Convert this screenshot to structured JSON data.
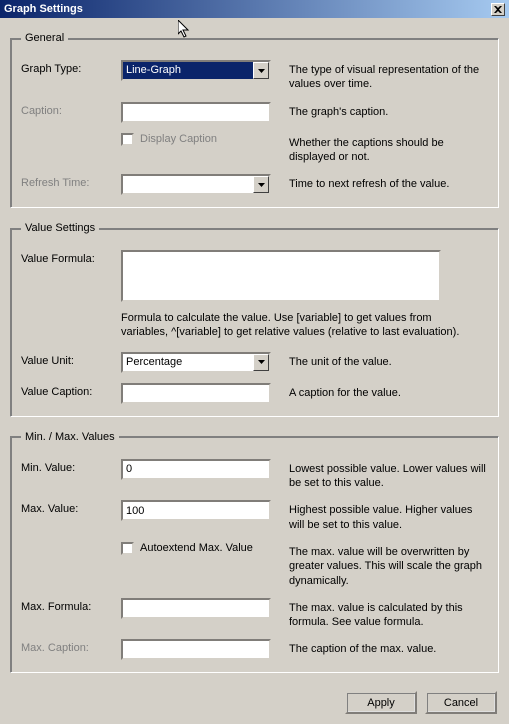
{
  "window": {
    "title": "Graph Settings"
  },
  "general": {
    "legend": "General",
    "graph_type": {
      "label": "Graph Type:",
      "value": "Line-Graph",
      "desc": "The type of visual representation of the values over time."
    },
    "caption": {
      "label": "Caption:",
      "value": "",
      "desc": "The graph's caption."
    },
    "display_caption": {
      "label": "Display Caption",
      "desc": "Whether the captions should be displayed or not."
    },
    "refresh_time": {
      "label": "Refresh Time:",
      "value": "",
      "desc": "Time to next refresh of the value."
    }
  },
  "value_settings": {
    "legend": "Value Settings",
    "formula": {
      "label": "Value Formula:",
      "value": "",
      "desc": "Formula to calculate the value. Use [variable] to get values from variables, ^[variable] to get relative values (relative to last evaluation)."
    },
    "unit": {
      "label": "Value Unit:",
      "value": "Percentage",
      "desc": "The unit of the value."
    },
    "caption": {
      "label": "Value Caption:",
      "value": "",
      "desc": "A caption for the value."
    }
  },
  "minmax": {
    "legend": "Min. / Max. Values",
    "min_value": {
      "label": "Min. Value:",
      "value": "0",
      "desc": "Lowest possible value. Lower values will be set to this value."
    },
    "max_value": {
      "label": "Max. Value:",
      "value": "100",
      "desc": "Highest possible value. Higher values will be set to this value."
    },
    "autoextend": {
      "label": "Autoextend Max. Value",
      "desc": "The max. value will be overwritten by greater values. This will scale the graph dynamically."
    },
    "max_formula": {
      "label": "Max. Formula:",
      "value": "",
      "desc": "The max. value is calculated by this formula. See value formula."
    },
    "max_caption": {
      "label": "Max. Caption:",
      "value": "",
      "desc": "The caption of the max. value."
    }
  },
  "buttons": {
    "apply": "Apply",
    "cancel": "Cancel"
  }
}
